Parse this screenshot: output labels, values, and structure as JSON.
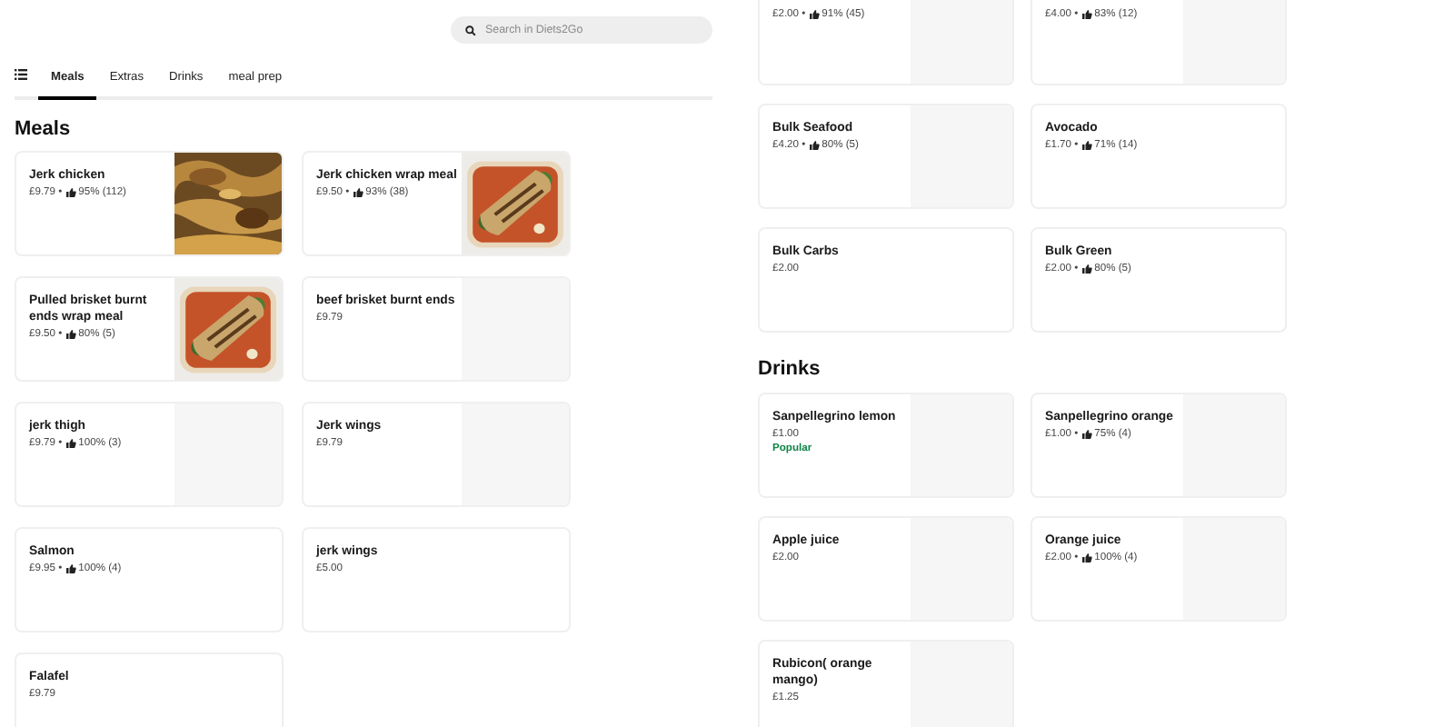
{
  "search": {
    "placeholder": "Search in Diets2Go"
  },
  "tabs": [
    {
      "label": "Meals",
      "selected": true
    },
    {
      "label": "Extras",
      "selected": false
    },
    {
      "label": "Drinks",
      "selected": false
    },
    {
      "label": "meal prep",
      "selected": false
    }
  ],
  "separator": "•",
  "left_section": {
    "title": "Meals",
    "items": [
      {
        "name": "Jerk chicken",
        "price": "£9.79",
        "rating": "95% (112)"
      },
      {
        "name": "Jerk chicken wrap meal",
        "price": "£9.50",
        "rating": "93% (38)"
      },
      {
        "name": "Pulled brisket burnt ends wrap meal",
        "price": "£9.50",
        "rating": "80% (5)"
      },
      {
        "kind": "placeholder",
        "name": "beef brisket burnt ends",
        "price": "£9.79"
      },
      {
        "kind": "placeholder",
        "name": "jerk thigh",
        "price": "£9.79",
        "rating": "100% (3)"
      },
      {
        "kind": "placeholder",
        "name": "Jerk wings",
        "price": "£9.79"
      },
      {
        "kind": "plain",
        "name": "Salmon",
        "price": "£9.95",
        "rating": "100% (4)"
      },
      {
        "kind": "plain",
        "name": "jerk wings",
        "price": "£5.00"
      },
      {
        "kind": "plain",
        "name": "Falafel",
        "price": "£9.79"
      }
    ]
  },
  "right_top_items": [
    {
      "kind": "placeholder",
      "price": "£2.00",
      "rating": "91% (45)"
    },
    {
      "kind": "placeholder",
      "price": "£4.00",
      "rating": "83% (12)"
    },
    {
      "kind": "placeholder",
      "name": "Bulk Seafood",
      "price": "£4.20",
      "rating": "80% (5)"
    },
    {
      "kind": "plain",
      "name": "Avocado",
      "price": "£1.70",
      "rating": "71% (14)"
    },
    {
      "kind": "plain",
      "name": "Bulk Carbs",
      "price": "£2.00"
    },
    {
      "kind": "plain",
      "name": "Bulk Green",
      "price": "£2.00",
      "rating": "80% (5)"
    }
  ],
  "drinks_section": {
    "title": "Drinks",
    "items": [
      {
        "kind": "placeholder",
        "name": "Sanpellegrino lemon",
        "price": "£1.00",
        "badge": "Popular"
      },
      {
        "kind": "placeholder",
        "name": "Sanpellegrino orange",
        "price": "£1.00",
        "rating": "75% (4)"
      },
      {
        "kind": "placeholder",
        "name": "Apple juice",
        "price": "£2.00"
      },
      {
        "kind": "placeholder",
        "name": "Orange juice",
        "price": "£2.00",
        "rating": "100% (4)"
      },
      {
        "kind": "placeholder",
        "name": "Rubicon( orange mango)",
        "price": "£1.25"
      }
    ]
  }
}
